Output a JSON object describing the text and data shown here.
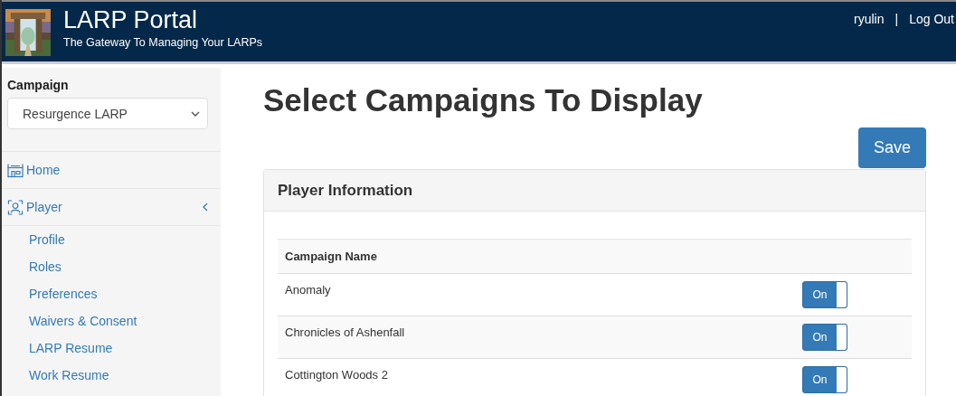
{
  "header": {
    "title": "LARP Portal",
    "subtitle": "The Gateway To Managing Your LARPs",
    "user": "ryulin",
    "separator": "|",
    "logout": "Log Out"
  },
  "sidebar": {
    "campaign_label": "Campaign",
    "campaign_value": "Resurgence LARP",
    "items": [
      {
        "label": "Home",
        "kind": "home"
      },
      {
        "label": "Player",
        "kind": "player",
        "expanded": true,
        "children": [
          {
            "label": "Profile"
          },
          {
            "label": "Roles"
          },
          {
            "label": "Preferences"
          },
          {
            "label": "Waivers & Consent"
          },
          {
            "label": "LARP Resume"
          },
          {
            "label": "Work Resume"
          }
        ]
      }
    ]
  },
  "page_title": "Select Campaigns To Display",
  "save_button": "Save",
  "panel": {
    "title": "Player Information",
    "table": {
      "columns": [
        "Campaign Name"
      ],
      "rows": [
        {
          "name": "Anomaly",
          "toggle": "On",
          "on": true
        },
        {
          "name": "Chronicles of Ashenfall",
          "toggle": "On",
          "on": true
        },
        {
          "name": "Cottington Woods 2",
          "toggle": "On",
          "on": true
        }
      ]
    }
  }
}
